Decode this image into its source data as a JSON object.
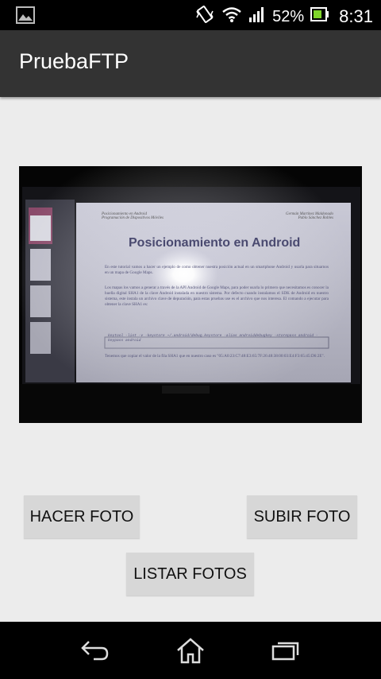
{
  "status_bar": {
    "battery_percent": "52%",
    "time": "8:31",
    "icons": [
      "image-notification-icon",
      "vibrate-icon",
      "wifi-icon",
      "signal-icon",
      "battery-icon"
    ]
  },
  "action_bar": {
    "title": "PruebaFTP"
  },
  "photo_preview": {
    "doc_header_left_1": "Posicionamiento en Android",
    "doc_header_left_2": "Programación de Dispositivos Móviles",
    "doc_header_right_1": "Germán Martínez Maldonado",
    "doc_header_right_2": "Pablo Sánchez Robles",
    "doc_title": "Posicionamiento en Android",
    "doc_para_1": "En este tutorial vamos a hacer un ejemplo de como obtener nuestra posición actual en un smartphone Android y usarla para situarnos en un mapa de Google Maps.",
    "doc_para_2": "Los mapas los vamos a generar a través de la API Android de Google Maps, para poder usarla lo primero que necesitamos es conocer la huella digital SHA1 de la clave Android instalada en nuestro sistema. Por defecto cuando instalamos el SDK de Android en nuestro sistema, este instala un archivo clave de depuración, para estas pruebas use es el archivo que nos interesa. El comando a ejecutar para obtener la clave SHA1 es:",
    "doc_code": "keytool -list -v -keystore ~/.android/debug.keystore -alias androiddebugkey -storepass android -keypass android",
    "doc_para_3": "Tenemos que copiar el valor de la fila SHA1 que en nuestro caso es \"05:A0:23:C7:48:E3:65:7F:26:48:38:00:03:E4:F3:65:45:D6:2E\"."
  },
  "buttons": {
    "hacer_foto": "HACER FOTO",
    "subir_foto": "SUBIR FOTO",
    "listar_fotos": "LISTAR FOTOS"
  },
  "nav_bar": {
    "icons": [
      "back-icon",
      "home-icon",
      "recent-apps-icon"
    ]
  },
  "colors": {
    "status_bar": "#000000",
    "action_bar": "#333333",
    "background": "#ececec",
    "button": "#d7d7d7",
    "nav_bar": "#000000"
  }
}
